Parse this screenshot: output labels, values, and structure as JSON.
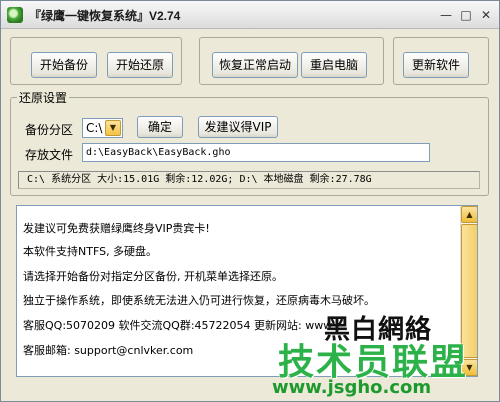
{
  "window": {
    "title": "『绿鹰一键恢复系统』V2.74",
    "minimize": "—",
    "maximize": "□",
    "close": "✕"
  },
  "toolbar": {
    "start_backup": "开始备份",
    "start_restore": "开始还原",
    "restore_normal_boot": "恢复正常启动",
    "restart_pc": "重启电脑",
    "update_software": "更新软件"
  },
  "restore_settings": {
    "legend": "还原设置",
    "partition_label": "备份分区",
    "partition_value": "C:\\",
    "confirm": "确定",
    "suggest_vip": "发建议得VIP",
    "file_label": "存放文件",
    "file_path": "d:\\EasyBack\\EasyBack.gho",
    "disk_status": "C:\\ 系统分区  大小:15.01G 剩余:12.02G; D:\\ 本地磁盘 剩余:27.78G"
  },
  "info": {
    "lines": [
      "发建议可免费获赠绿鹰终身VIP贵宾卡!",
      "本软件支持NTFS, 多硬盘。",
      "请选择开始备份对指定分区备份, 开机菜单选择还原。",
      "独立于操作系统，即使系统无法进入仍可进行恢复，还原病毒木马破坏。",
      "客服QQ:5070209 软件交流QQ群:45722054 更新网站: www.c",
      "客服邮箱:  support@cnlvker.com"
    ]
  },
  "watermark": {
    "top": "黑白網絡",
    "main": "技术员联盟",
    "url": "www.jsgho.com"
  }
}
